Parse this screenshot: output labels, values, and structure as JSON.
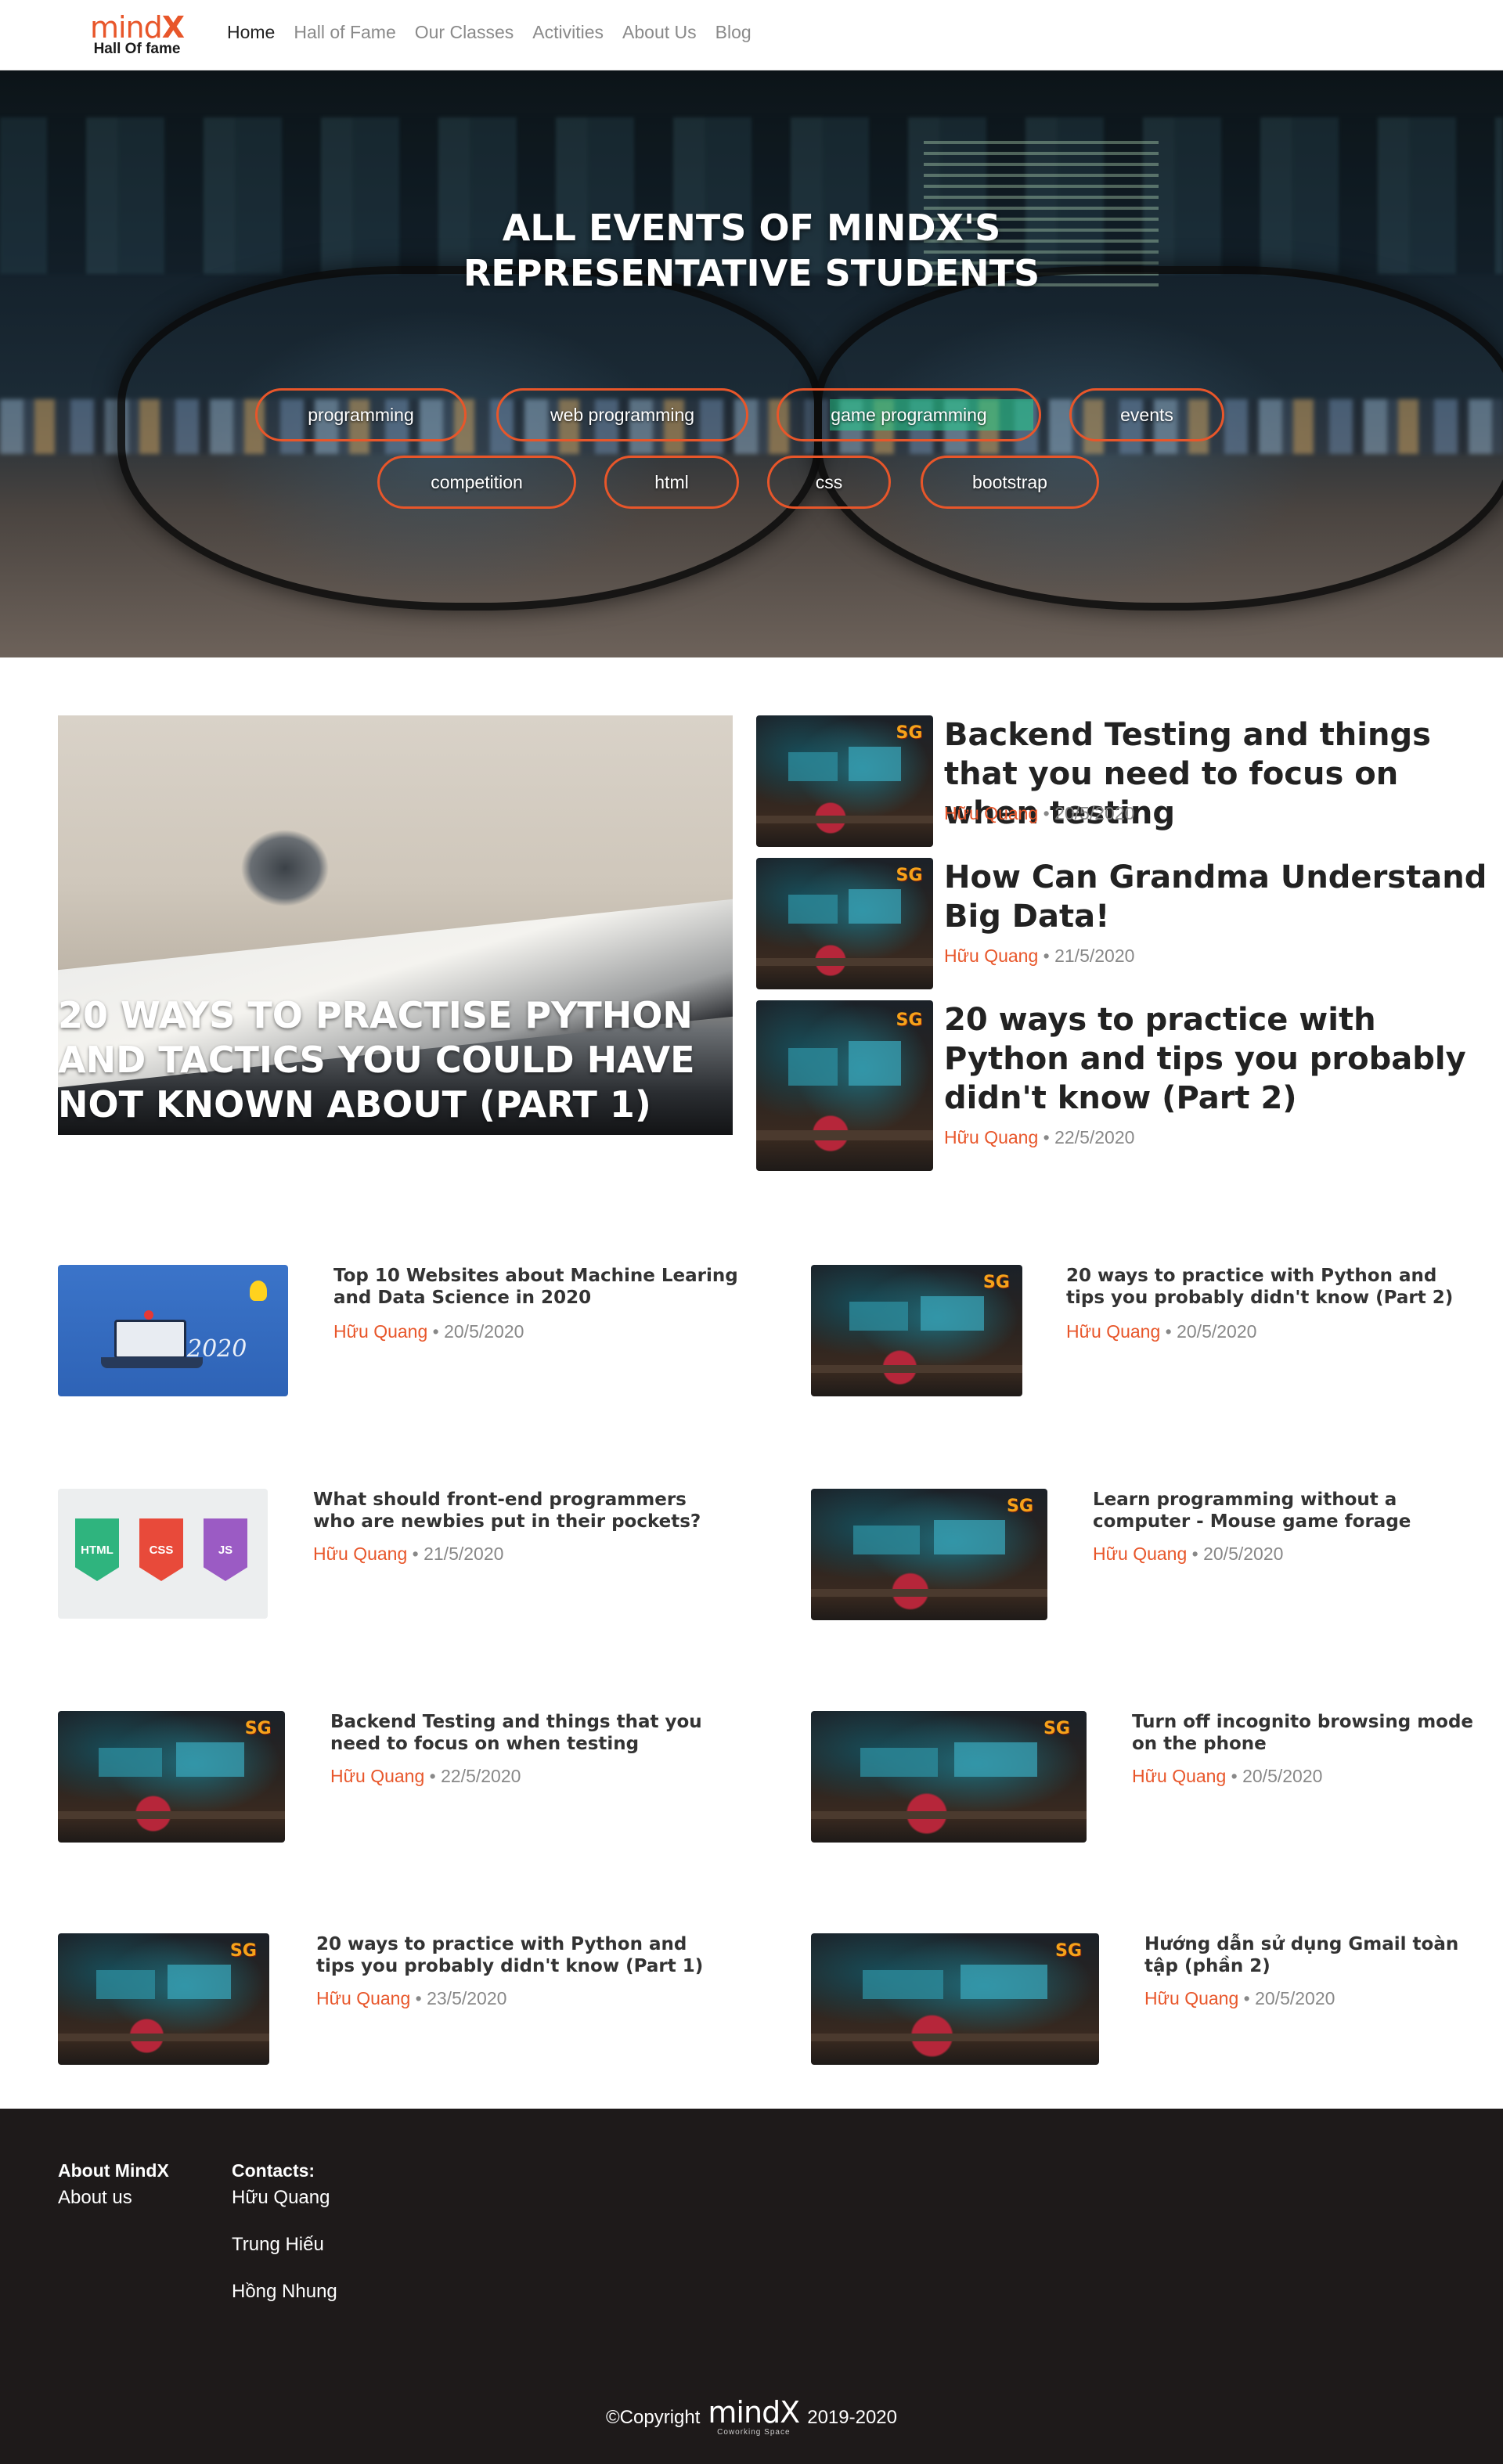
{
  "brand": {
    "logo_word": "mind",
    "logo_x": "X",
    "logo_sub": "Hall Of fame"
  },
  "nav": [
    {
      "label": "Home"
    },
    {
      "label": "Hall of Fame"
    },
    {
      "label": "Our Classes"
    },
    {
      "label": "Activities"
    },
    {
      "label": "About Us"
    },
    {
      "label": "Blog"
    }
  ],
  "hero": {
    "title_line1": "ALL EVENTS OF MINDX'S",
    "title_line2": "REPRESENTATIVE STUDENTS",
    "tags": [
      {
        "label": "programming"
      },
      {
        "label": "web programming"
      },
      {
        "label": "game programming"
      },
      {
        "label": "events"
      },
      {
        "label": "competition"
      },
      {
        "label": "html"
      },
      {
        "label": "css"
      },
      {
        "label": "bootstrap"
      }
    ]
  },
  "featured": {
    "title": "20 WAYS TO PRACTISE PYTHON AND TACTICS YOU COULD HAVE NOT KNOWN ABOUT (PART 1)"
  },
  "side_posts": [
    {
      "title": "Backend Testing and things that you need to focus on when testing",
      "author": "Hữu Quang",
      "date": "20/5/2020"
    },
    {
      "title": "How Can Grandma Understand Big Data!",
      "author": "Hữu Quang",
      "date": "21/5/2020"
    },
    {
      "title": "20 ways to practice with Python and tips you probably didn't know (Part 2)",
      "author": "Hữu Quang",
      "date": "22/5/2020"
    }
  ],
  "grid_posts": [
    {
      "title": "Top 10 Websites about Machine Learing and Data Science in 2020",
      "author": "Hữu Quang",
      "date": "20/5/2020",
      "thumb_text": "2020"
    },
    {
      "title": "20 ways to practice with Python and tips you probably didn't know (Part 2)",
      "author": "Hữu Quang",
      "date": "20/5/2020"
    },
    {
      "title": "What should front-end programmers who are newbies put in their pockets?",
      "author": "Hữu Quang",
      "date": "21/5/2020",
      "thumb_labels": [
        "HTML",
        "CSS",
        "JS"
      ]
    },
    {
      "title": "Learn programming without a computer - Mouse game forage",
      "author": "Hữu Quang",
      "date": "20/5/2020"
    },
    {
      "title": "Backend Testing and things that you need to focus on when testing",
      "author": "Hữu Quang",
      "date": "22/5/2020"
    },
    {
      "title": "Turn off incognito browsing mode on the phone",
      "author": "Hữu Quang",
      "date": "20/5/2020"
    },
    {
      "title": "20 ways to practice with Python and tips you probably didn't know (Part 1)",
      "author": "Hữu Quang",
      "date": "23/5/2020"
    },
    {
      "title": "Hướng dẫn sử dụng Gmail toàn tập (phần 2)",
      "author": "Hữu Quang",
      "date": "20/5/2020"
    }
  ],
  "meta_separator": "•",
  "thumb_badge": "SG",
  "footer": {
    "about_heading": "About MindX",
    "about_link": "About us",
    "contacts_heading": "Contacts:",
    "contacts": [
      "Hữu Quang",
      "Trung Hiếu",
      "Hồng Nhung"
    ],
    "copyright_prefix": "©Copyright",
    "copyright_brand": "mindX",
    "copyright_brand_sub": "Coworking Space",
    "copyright_years": "2019-2020"
  },
  "colors": {
    "accent": "#e8562a",
    "footer_bg": "#1e1a1a",
    "meta_gray": "#888888"
  }
}
